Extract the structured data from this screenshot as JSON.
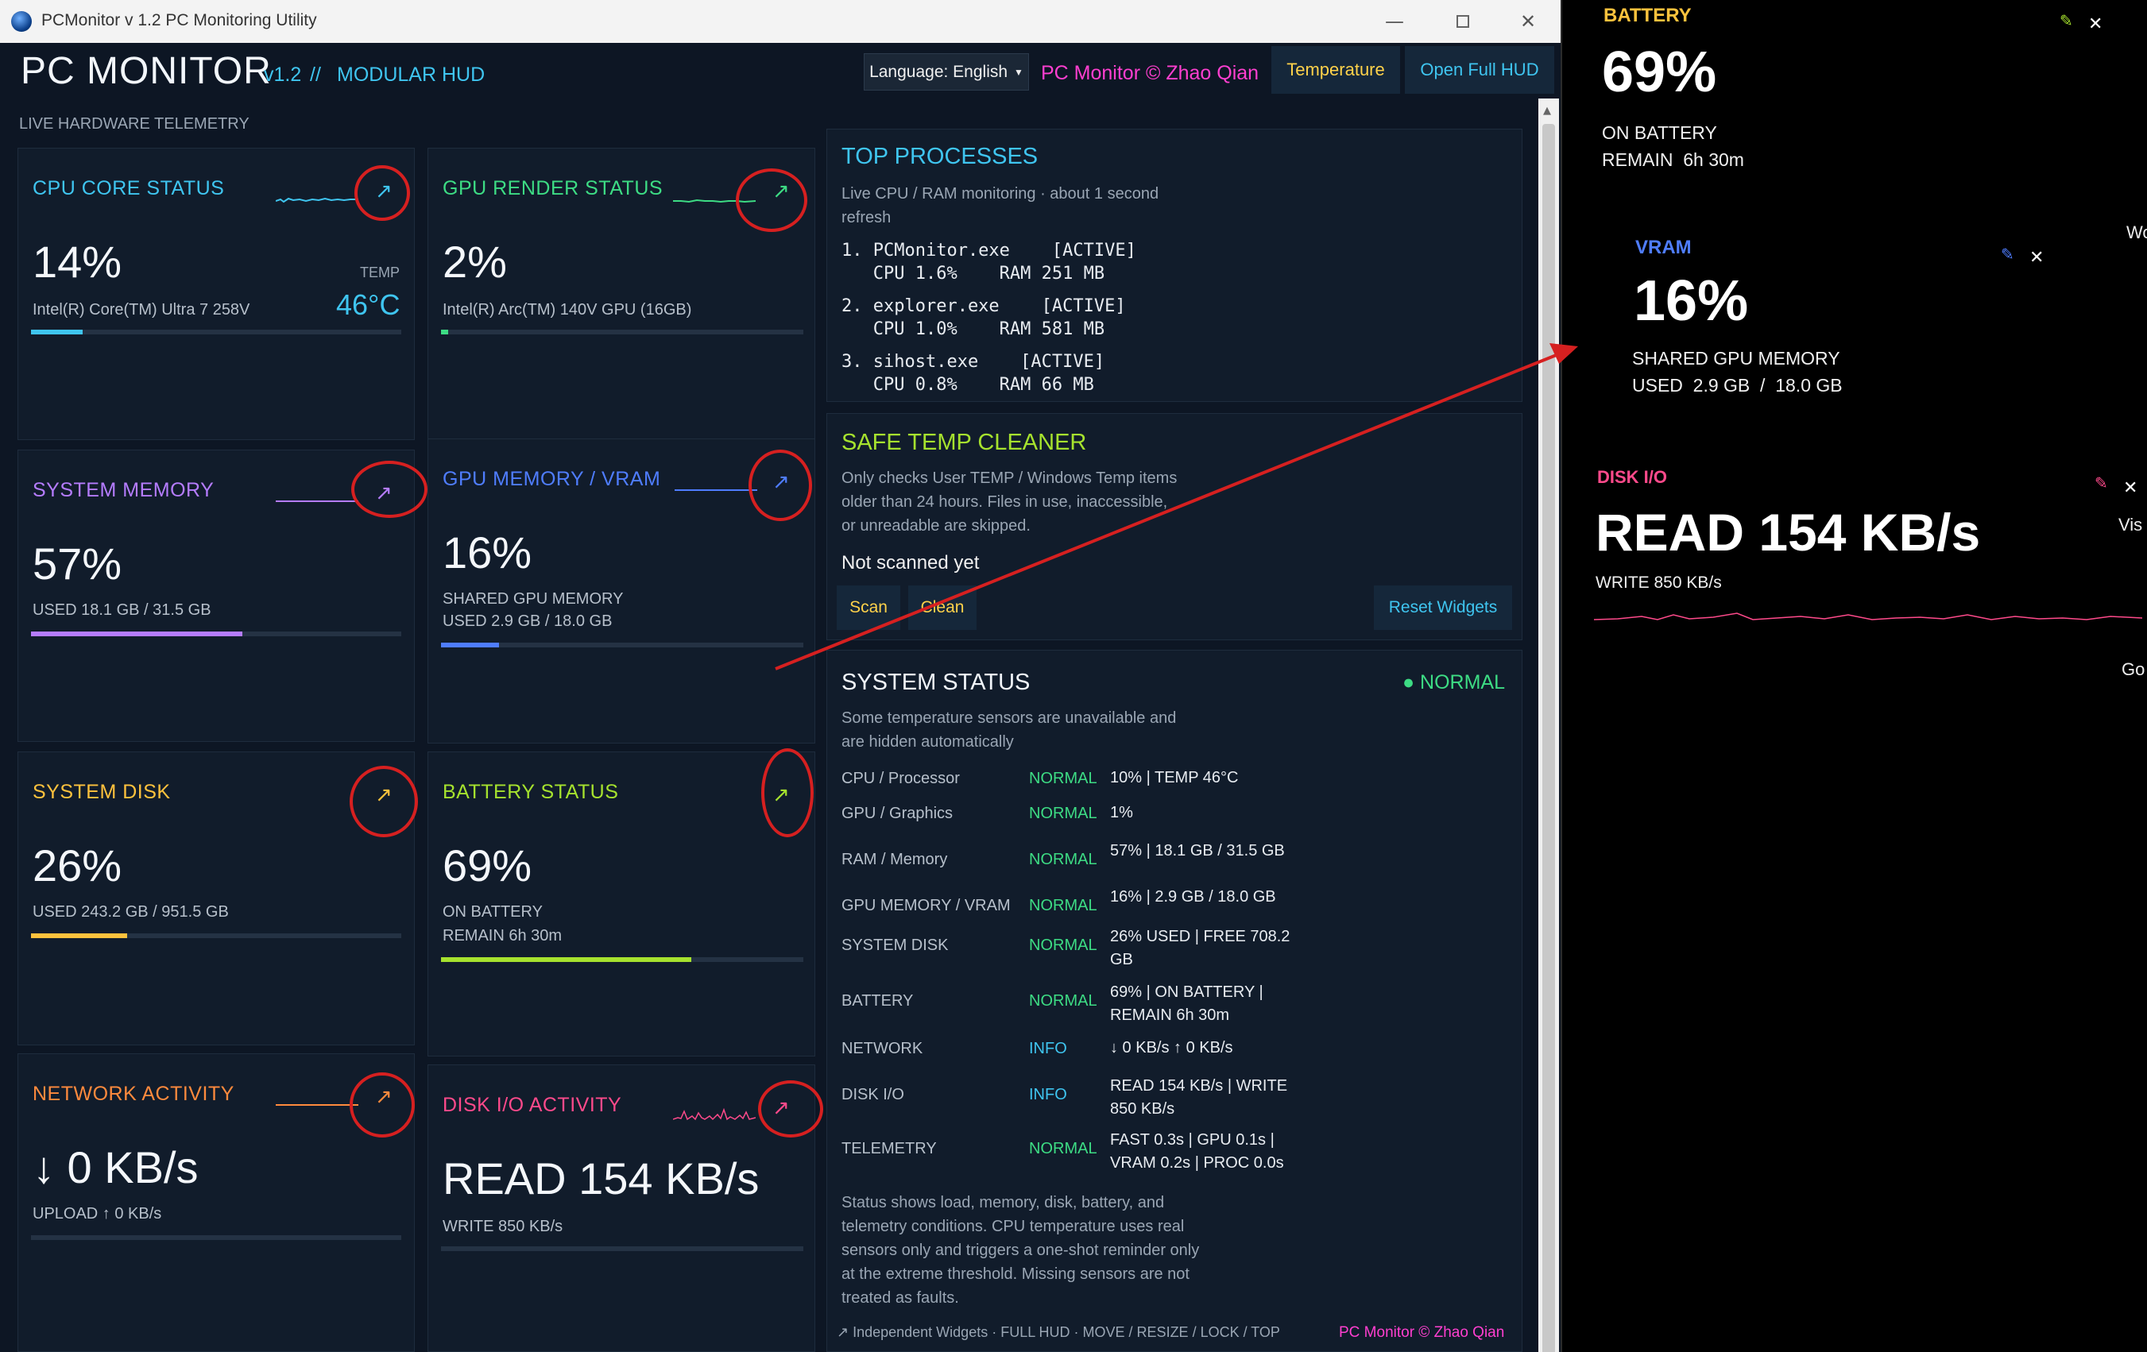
{
  "window": {
    "title": "PCMonitor v 1.2 PC Monitoring Utility",
    "min_icon": "minimize-icon",
    "max_icon": "maximize-icon",
    "close_icon": "close-icon"
  },
  "header": {
    "title": "PC MONITOR",
    "version": "v1.2",
    "separator": "//",
    "subtitle": "MODULAR HUD",
    "language": "Language: English",
    "copyright": "PC Monitor © Zhao Qian",
    "temperature_btn": "Temperature",
    "open_hud_btn": "Open Full HUD",
    "section_label": "LIVE HARDWARE TELEMETRY"
  },
  "cards": {
    "cpu": {
      "title": "CPU CORE STATUS",
      "value": "14%",
      "temp_label": "TEMP",
      "temp": "46°C",
      "sub": "Intel(R) Core(TM) Ultra 7 258V",
      "fill": 0.14,
      "color": "#3fc5f0"
    },
    "gpu": {
      "title": "GPU RENDER STATUS",
      "value": "2%",
      "sub": "Intel(R) Arc(TM) 140V GPU (16GB)",
      "fill": 0.02,
      "color": "#3ddc84"
    },
    "mem": {
      "title": "SYSTEM MEMORY",
      "value": "57%",
      "sub": "USED  18.1 GB  /  31.5 GB",
      "fill": 0.57,
      "color": "#b57cff"
    },
    "vram": {
      "title": "GPU MEMORY / VRAM",
      "value": "16%",
      "sub1": "SHARED GPU MEMORY",
      "sub2": "USED  2.9 GB  /  18.0 GB",
      "fill": 0.16,
      "color": "#4f7dff"
    },
    "disk": {
      "title": "SYSTEM DISK",
      "value": "26%",
      "sub": "USED  243.2 GB  /  951.5 GB",
      "fill": 0.26,
      "color": "#ffc23d"
    },
    "battery": {
      "title": "BATTERY STATUS",
      "value": "69%",
      "sub1": "ON BATTERY",
      "sub2": "REMAIN  6h 30m",
      "fill": 0.69,
      "color": "#a6e22e"
    },
    "network": {
      "title": "NETWORK ACTIVITY",
      "value": "↓ 0 KB/s",
      "sub": "UPLOAD  ↑ 0 KB/s",
      "color": "#ff8a3d"
    },
    "diskio": {
      "title": "DISK I/O ACTIVITY",
      "value": "READ 154 KB/s",
      "sub": "WRITE 850 KB/s",
      "color": "#ff4a8b"
    },
    "arrow_icon": "↗"
  },
  "processes": {
    "title": "TOP PROCESSES",
    "desc": "Live CPU / RAM monitoring · about 1 second refresh",
    "items": [
      {
        "line1": "1. PCMonitor.exe    [ACTIVE]",
        "line2": "   CPU 1.6%    RAM 251 MB"
      },
      {
        "line1": "2. explorer.exe    [ACTIVE]",
        "line2": "   CPU 1.0%    RAM 581 MB"
      },
      {
        "line1": "3. sihost.exe    [ACTIVE]",
        "line2": "   CPU 0.8%    RAM 66 MB"
      }
    ]
  },
  "cleaner": {
    "title": "SAFE TEMP CLEANER",
    "desc": "Only checks User TEMP / Windows Temp items older than 24 hours. Files in use, inaccessible, or unreadable are skipped.",
    "status": "Not scanned yet",
    "scan": "Scan",
    "clean": "Clean",
    "reset": "Reset Widgets"
  },
  "system_status": {
    "title": "SYSTEM STATUS",
    "badge": "● NORMAL",
    "desc": "Some temperature sensors are unavailable and are hidden automatically",
    "rows": [
      {
        "name": "CPU / Processor",
        "status": "NORMAL",
        "value": "10%  |  TEMP 46°C"
      },
      {
        "name": "GPU / Graphics",
        "status": "NORMAL",
        "value": "1%"
      },
      {
        "name": "RAM / Memory",
        "status": "NORMAL",
        "value": "57%  |  18.1 GB / 31.5 GB"
      },
      {
        "name": "GPU MEMORY / VRAM",
        "status": "NORMAL",
        "value": "16%  |  2.9 GB / 18.0 GB"
      },
      {
        "name": "SYSTEM DISK",
        "status": "NORMAL",
        "value": "26% USED  |  FREE 708.2 GB"
      },
      {
        "name": "BATTERY",
        "status": "NORMAL",
        "value": "69%  |  ON BATTERY  |  REMAIN 6h 30m"
      },
      {
        "name": "NETWORK",
        "status": "INFO",
        "value": "↓ 0 KB/s  ↑ 0 KB/s"
      },
      {
        "name": "DISK I/O",
        "status": "INFO",
        "value": "READ 154 KB/s  |  WRITE 850 KB/s"
      },
      {
        "name": "TELEMETRY",
        "status": "NORMAL",
        "value": "FAST 0.3s  |  GPU 0.1s  |  VRAM 0.2s  |  PROC 0.0s"
      }
    ],
    "footer_desc": "Status shows load, memory, disk, battery, and telemetry conditions. CPU temperature uses real sensors only and triggers a one-shot reminder only at the extreme threshold. Missing sensors are not treated as faults.",
    "footer_left": "↗ Independent Widgets  ·  FULL HUD  ·  MOVE / RESIZE / LOCK / TOP",
    "footer_right": "PC Monitor © Zhao Qian",
    "colors": {
      "normal": "#3ddc84",
      "info": "#3fc5f0"
    }
  },
  "overlay": {
    "battery": {
      "title": "BATTERY",
      "value": "69%",
      "sub1": "ON BATTERY",
      "sub2": "REMAIN  6h 30m",
      "color": "#ffc23d"
    },
    "vram": {
      "title": "VRAM",
      "value": "16%",
      "sub1": "SHARED GPU MEMORY",
      "sub2": "USED  2.9 GB  /  18.0 GB",
      "color": "#4f7dff"
    },
    "diskio": {
      "title": "DISK I/O",
      "value": "READ 154 KB/s",
      "sub": "WRITE 850 KB/s",
      "color": "#ff4a8b"
    },
    "pencil_icon": "✎",
    "close_icon": "✕",
    "edge_labels": [
      "Wo",
      "Vis",
      "Go"
    ]
  }
}
